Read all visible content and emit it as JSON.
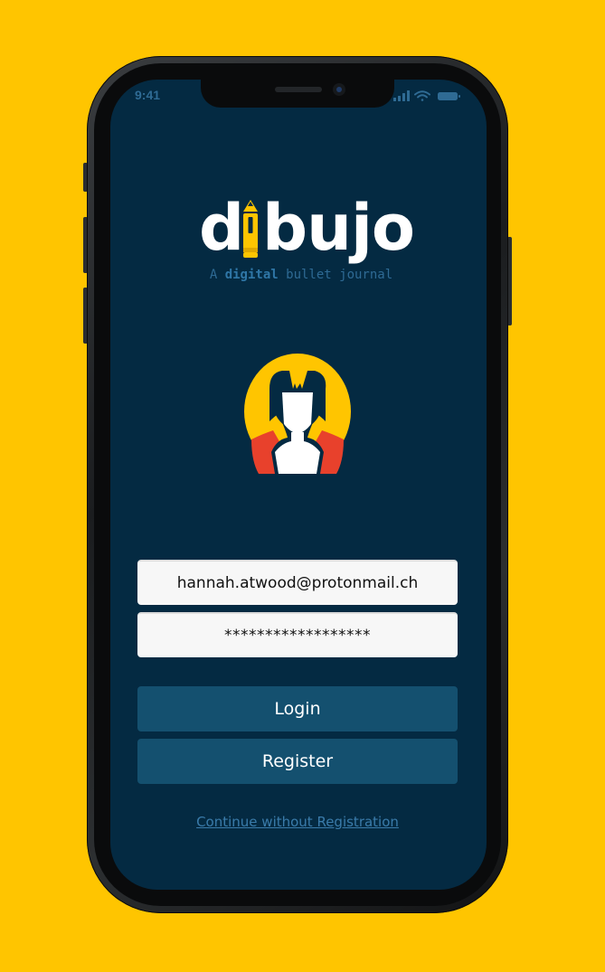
{
  "status_bar": {
    "time": "9:41"
  },
  "logo": {
    "prefix": "d",
    "suffix": "bujo"
  },
  "tagline": {
    "before": "A ",
    "emphasis": "digital",
    "after": " bullet journal"
  },
  "login_form": {
    "email_value": "hannah.atwood@protonmail.ch",
    "password_value": "******************"
  },
  "actions": {
    "login_label": "Login",
    "register_label": "Register",
    "continue_label": "Continue without Registration"
  },
  "colors": {
    "background": "#FFC500",
    "screen": "#042A42",
    "accent_yellow": "#FFC500",
    "button": "#14506F",
    "link": "#3A7BAA",
    "avatar_red": "#E8412C"
  },
  "icons": [
    "cellular-signal-icon",
    "wifi-icon",
    "battery-icon",
    "pencil-icon",
    "avatar-icon"
  ]
}
